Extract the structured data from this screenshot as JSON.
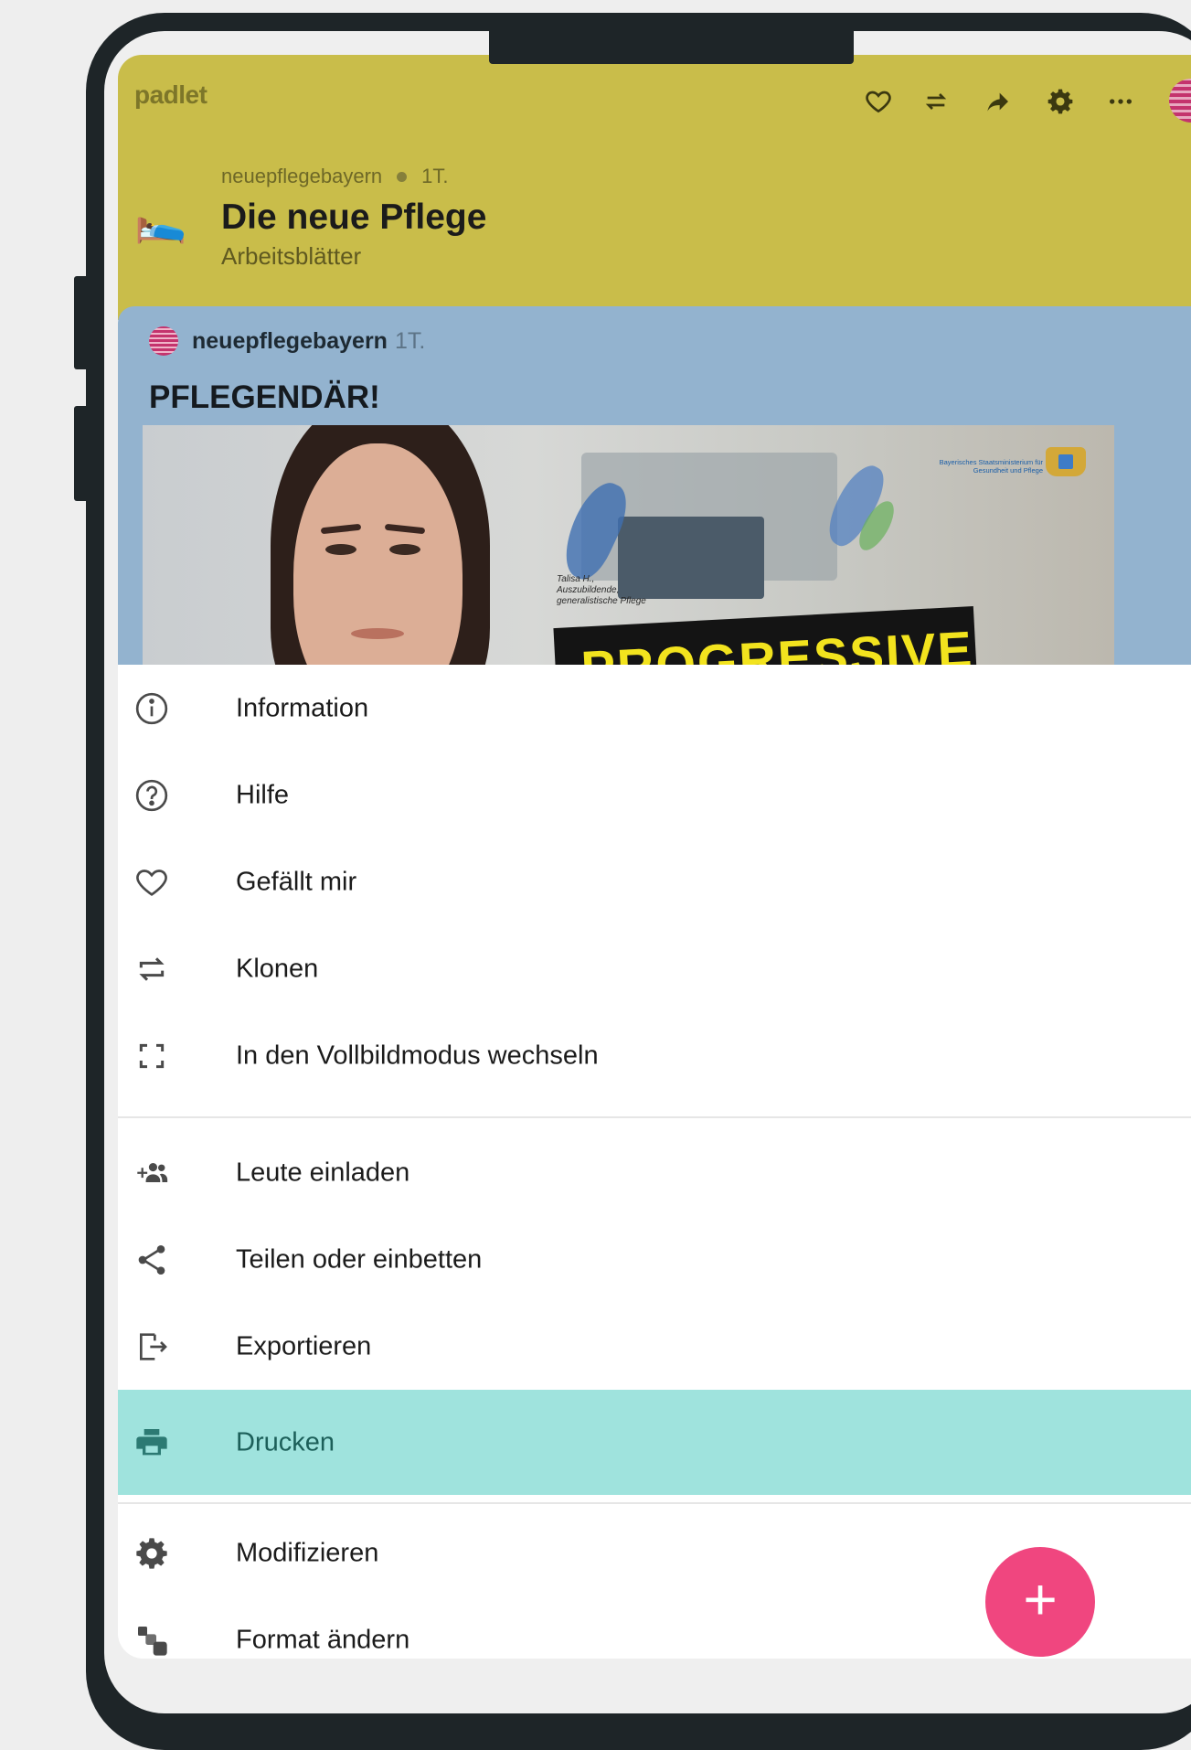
{
  "app": {
    "logo": "padlet"
  },
  "board": {
    "emoji": "🛌",
    "author": "neuepflegebayern",
    "age": "1T.",
    "title": "Die neue Pflege",
    "subtitle": "Arbeitsblätter"
  },
  "toolbar": {
    "icons": [
      "heart-icon",
      "remake-icon",
      "share-icon",
      "gear-icon",
      "more-icon"
    ]
  },
  "post": {
    "author": "neuepflegebayern",
    "age": "1T.",
    "title": "PFLEGENDÄR!",
    "image": {
      "caption_lines": [
        "Talisa H.,",
        "Auszubildende,",
        "generalistische Pflege"
      ],
      "ministry_lines": [
        "Bayerisches Staatsministerium für",
        "Gesundheit und Pflege"
      ],
      "banner_text": "PROGRESSIVE"
    }
  },
  "menu": {
    "items": [
      {
        "label": "Information",
        "icon": "info-icon"
      },
      {
        "label": "Hilfe",
        "icon": "help-icon"
      },
      {
        "label": "Gefällt mir",
        "icon": "heart-icon"
      },
      {
        "label": "Klonen",
        "icon": "remake-icon"
      },
      {
        "label": "In den Vollbildmodus wechseln",
        "icon": "fullscreen-icon"
      },
      {
        "label": "Leute einladen",
        "icon": "add-people-icon"
      },
      {
        "label": "Teilen oder einbetten",
        "icon": "share-icon"
      },
      {
        "label": "Exportieren",
        "icon": "export-icon"
      },
      {
        "label": "Drucken",
        "icon": "print-icon",
        "active": true
      },
      {
        "label": "Modifizieren",
        "icon": "gear-icon"
      },
      {
        "label": "Format ändern",
        "icon": "format-icon"
      }
    ]
  },
  "fab": {
    "label": "+"
  },
  "colors": {
    "header": "#c9bd4a",
    "post_background": "#93b3cf",
    "active_item": "#9fe3dd",
    "fab": "#f0467f"
  }
}
